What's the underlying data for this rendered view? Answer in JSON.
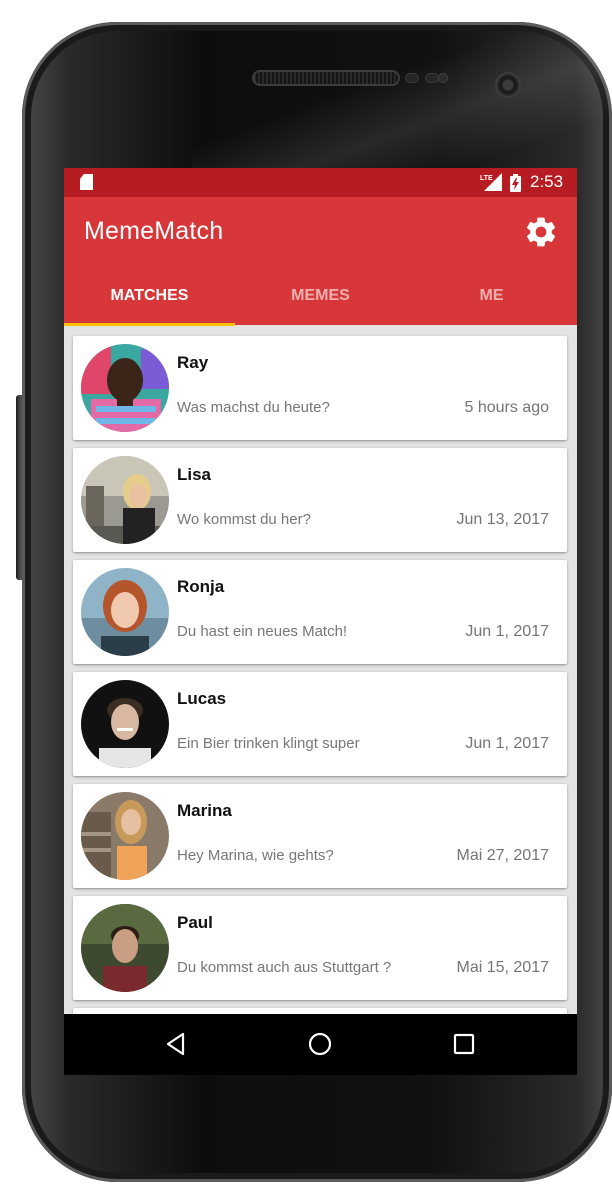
{
  "status_bar": {
    "time": "2:53",
    "network_label": "LTE"
  },
  "app": {
    "title": "MemeMatch"
  },
  "tabs": [
    {
      "label": "MATCHES",
      "active": true
    },
    {
      "label": "MEMES",
      "active": false
    },
    {
      "label": "ME",
      "active": false
    }
  ],
  "matches": [
    {
      "name": "Ray",
      "message": "Was machst du heute?",
      "time": "5 hours ago"
    },
    {
      "name": "Lisa",
      "message": "Wo kommst du her?",
      "time": "Jun 13, 2017"
    },
    {
      "name": "Ronja",
      "message": "Du hast ein neues Match!",
      "time": "Jun 1, 2017"
    },
    {
      "name": "Lucas",
      "message": "Ein Bier trinken klingt super",
      "time": "Jun 1, 2017"
    },
    {
      "name": "Marina",
      "message": "Hey Marina, wie gehts?",
      "time": "Mai 27, 2017"
    },
    {
      "name": "Paul",
      "message": "Du kommst auch aus Stuttgart ?",
      "time": "Mai 15, 2017"
    }
  ],
  "icons": {
    "settings": "gear-icon",
    "sd_card": "sd-card-icon",
    "signal": "lte-signal-icon",
    "battery": "battery-charging-icon",
    "nav_back": "back-triangle-icon",
    "nav_home": "home-circle-icon",
    "nav_recents": "recents-square-icon"
  },
  "colors": {
    "status_bar": "#b71c22",
    "app_bar": "#d8373a",
    "tab_indicator": "#ffc107",
    "list_background": "#e4e4e4",
    "card_background": "#ffffff"
  }
}
